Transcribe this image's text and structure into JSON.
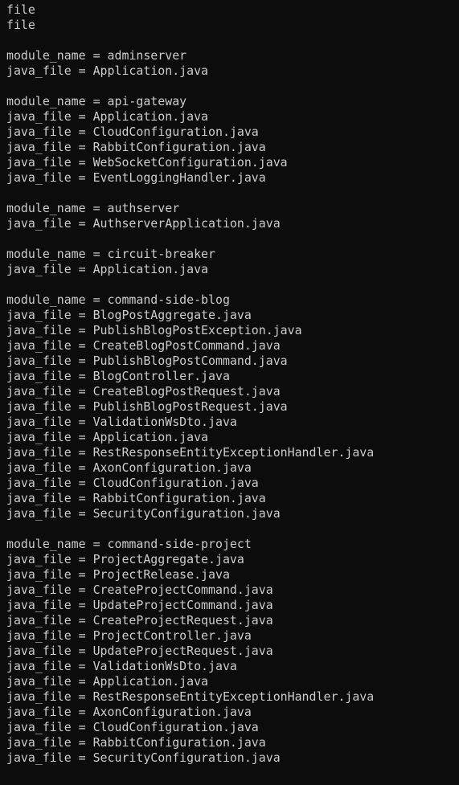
{
  "terminal": {
    "lines": [
      "file",
      "file",
      "",
      "module_name = adminserver",
      "java_file = Application.java",
      "",
      "module_name = api-gateway",
      "java_file = Application.java",
      "java_file = CloudConfiguration.java",
      "java_file = RabbitConfiguration.java",
      "java_file = WebSocketConfiguration.java",
      "java_file = EventLoggingHandler.java",
      "",
      "module_name = authserver",
      "java_file = AuthserverApplication.java",
      "",
      "module_name = circuit-breaker",
      "java_file = Application.java",
      "",
      "module_name = command-side-blog",
      "java_file = BlogPostAggregate.java",
      "java_file = PublishBlogPostException.java",
      "java_file = CreateBlogPostCommand.java",
      "java_file = PublishBlogPostCommand.java",
      "java_file = BlogController.java",
      "java_file = CreateBlogPostRequest.java",
      "java_file = PublishBlogPostRequest.java",
      "java_file = ValidationWsDto.java",
      "java_file = Application.java",
      "java_file = RestResponseEntityExceptionHandler.java",
      "java_file = AxonConfiguration.java",
      "java_file = CloudConfiguration.java",
      "java_file = RabbitConfiguration.java",
      "java_file = SecurityConfiguration.java",
      "",
      "module_name = command-side-project",
      "java_file = ProjectAggregate.java",
      "java_file = ProjectRelease.java",
      "java_file = CreateProjectCommand.java",
      "java_file = UpdateProjectCommand.java",
      "java_file = CreateProjectRequest.java",
      "java_file = ProjectController.java",
      "java_file = UpdateProjectRequest.java",
      "java_file = ValidationWsDto.java",
      "java_file = Application.java",
      "java_file = RestResponseEntityExceptionHandler.java",
      "java_file = AxonConfiguration.java",
      "java_file = CloudConfiguration.java",
      "java_file = RabbitConfiguration.java",
      "java_file = SecurityConfiguration.java"
    ]
  },
  "colors": {
    "background": "#0c0c0c",
    "foreground": "#cccccc"
  }
}
